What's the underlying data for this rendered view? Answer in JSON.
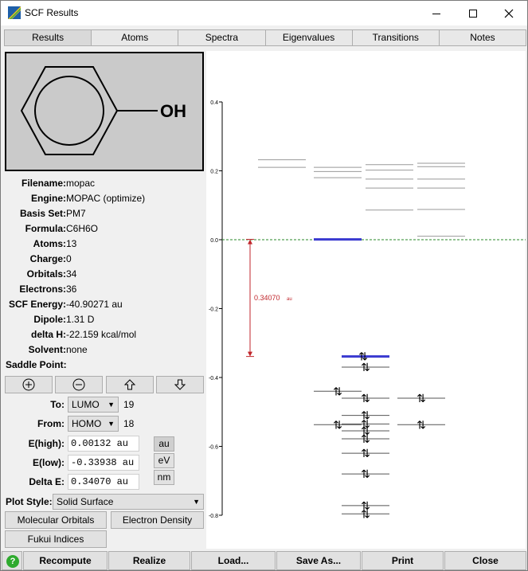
{
  "window": {
    "title": "SCF Results",
    "controls": [
      "minimize-icon",
      "maximize-icon",
      "close-icon"
    ]
  },
  "tabs": [
    {
      "label": "Results",
      "active": true
    },
    {
      "label": "Atoms"
    },
    {
      "label": "Spectra"
    },
    {
      "label": "Eigenvalues"
    },
    {
      "label": "Transitions"
    },
    {
      "label": "Notes"
    }
  ],
  "molecule": {
    "substituent": "OH"
  },
  "info": [
    {
      "label": "Filename:",
      "value": "mopac"
    },
    {
      "label": "Engine:",
      "value": "MOPAC (optimize)"
    },
    {
      "label": "Basis Set:",
      "value": "PM7"
    },
    {
      "label": "Formula:",
      "value": "C6H6O"
    },
    {
      "label": "Atoms:",
      "value": "13"
    },
    {
      "label": "Charge:",
      "value": "0"
    },
    {
      "label": "Orbitals:",
      "value": "34"
    },
    {
      "label": "Electrons:",
      "value": "36"
    },
    {
      "label": "SCF Energy:",
      "value": "-40.90271 au"
    },
    {
      "label": "Dipole:",
      "value": "1.31 D"
    },
    {
      "label": "delta H:",
      "value": "-22.159 kcal/mol"
    },
    {
      "label": "Solvent:",
      "value": "none"
    },
    {
      "label": "Saddle Point:",
      "value": ""
    }
  ],
  "nav": [
    "zoom-in-icon",
    "zoom-out-icon",
    "arrow-up-icon",
    "arrow-down-icon"
  ],
  "to": {
    "label": "To:",
    "selected": "LUMO",
    "number": "19"
  },
  "from": {
    "label": "From:",
    "selected": "HOMO",
    "number": "18"
  },
  "energies": {
    "high": {
      "label": "E(high):",
      "value": "0.00132 au"
    },
    "low": {
      "label": "E(low):",
      "value": "-0.33938 au"
    },
    "delta": {
      "label": "Delta E:",
      "value": "0.34070 au"
    }
  },
  "units": [
    "au",
    "eV",
    "nm"
  ],
  "plot_style": {
    "label": "Plot Style:",
    "selected": "Solid Surface"
  },
  "buttons": {
    "molecular_orbitals": "Molecular Orbitals",
    "electron_density": "Electron Density",
    "fukui": "Fukui Indices"
  },
  "bottom": [
    "Recompute",
    "Realize",
    "Load...",
    "Save As...",
    "Print",
    "Close"
  ],
  "chart_data": {
    "type": "scatter",
    "title": "",
    "ylabel": "",
    "ylim": [
      -0.8,
      0.4
    ],
    "yticks": [
      "0.4",
      "0.2",
      "0.0",
      "-0.2",
      "-0.4",
      "-0.6",
      "-0.8"
    ],
    "gap_label": "0.34070",
    "gap_unit": "au",
    "homo": -0.339,
    "lumo": 0.001,
    "levels": [
      {
        "e": 0.232,
        "col": 0
      },
      {
        "e": 0.21,
        "col": 0
      },
      {
        "e": 0.21,
        "col": 1
      },
      {
        "e": 0.198,
        "col": 1
      },
      {
        "e": 0.218,
        "col": 2
      },
      {
        "e": 0.202,
        "col": 2
      },
      {
        "e": 0.222,
        "col": 3
      },
      {
        "e": 0.212,
        "col": 3
      },
      {
        "e": 0.18,
        "col": 1
      },
      {
        "e": 0.176,
        "col": 2
      },
      {
        "e": 0.176,
        "col": 3
      },
      {
        "e": 0.15,
        "col": 2
      },
      {
        "e": 0.15,
        "col": 3
      },
      {
        "e": 0.086,
        "col": 2
      },
      {
        "e": 0.088,
        "col": 3
      },
      {
        "e": 0.01,
        "col": 3
      },
      {
        "e": 0.001,
        "col": 2,
        "lumo": true
      },
      {
        "e": -0.339,
        "col": 2,
        "occ": true,
        "homo": true
      },
      {
        "e": -0.37,
        "col": 2,
        "occ": true
      },
      {
        "e": -0.44,
        "col": 1,
        "occ": true
      },
      {
        "e": -0.46,
        "col": 2,
        "occ": true
      },
      {
        "e": -0.46,
        "col": 3,
        "occ": true
      },
      {
        "e": -0.51,
        "col": 2,
        "occ": true
      },
      {
        "e": -0.537,
        "col": 1,
        "occ": true
      },
      {
        "e": -0.535,
        "col": 2,
        "occ": true
      },
      {
        "e": -0.537,
        "col": 3,
        "occ": true
      },
      {
        "e": -0.555,
        "col": 2,
        "occ": true
      },
      {
        "e": -0.578,
        "col": 2,
        "occ": true
      },
      {
        "e": -0.62,
        "col": 2,
        "occ": true
      },
      {
        "e": -0.68,
        "col": 2,
        "occ": true
      },
      {
        "e": -0.772,
        "col": 2,
        "occ": true
      },
      {
        "e": -0.796,
        "col": 2,
        "occ": true
      }
    ]
  }
}
